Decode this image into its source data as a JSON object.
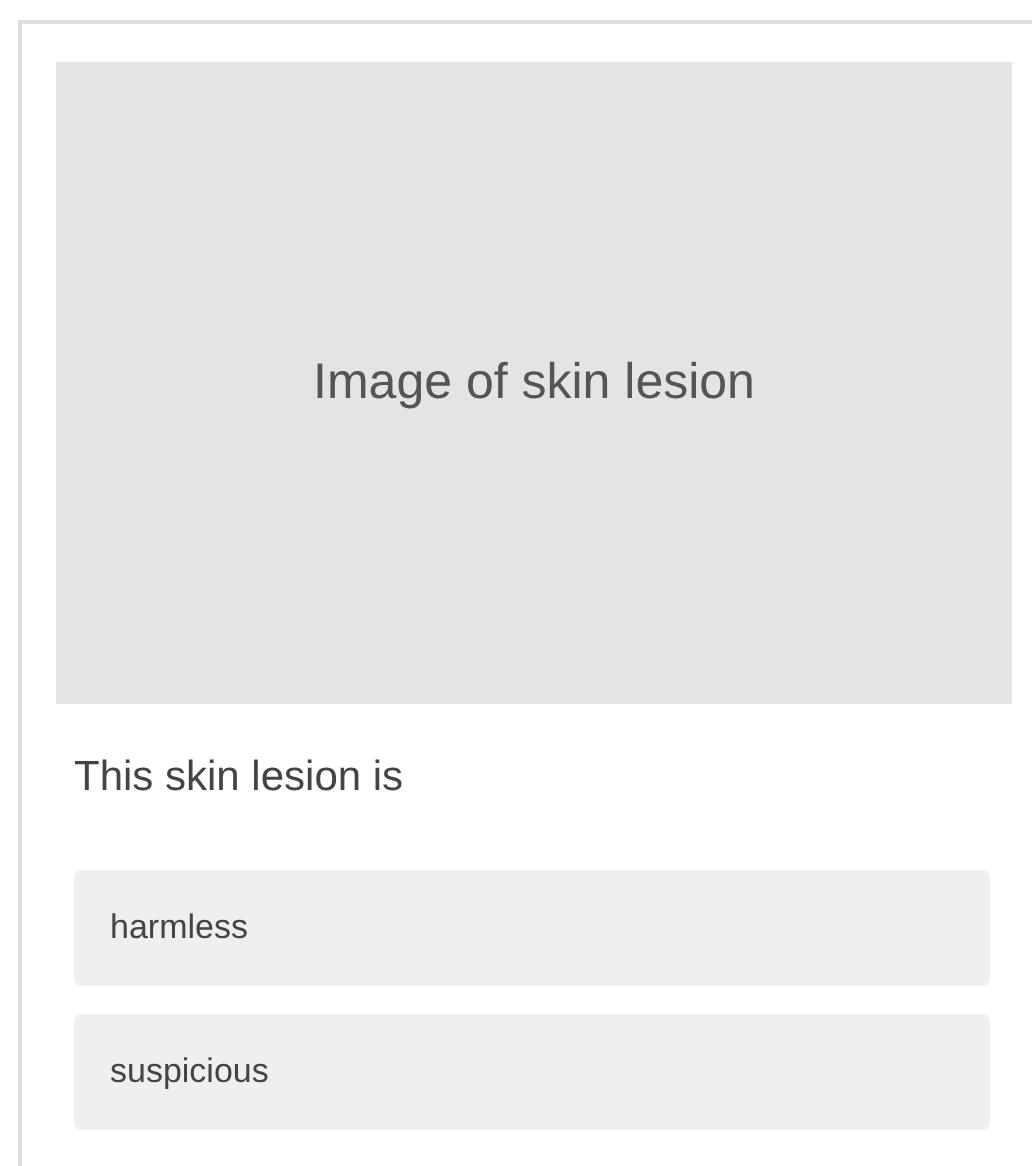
{
  "image_placeholder": {
    "label": "Image of skin lesion"
  },
  "question": "This skin lesion is",
  "options": [
    {
      "label": "harmless"
    },
    {
      "label": "suspicious"
    }
  ]
}
